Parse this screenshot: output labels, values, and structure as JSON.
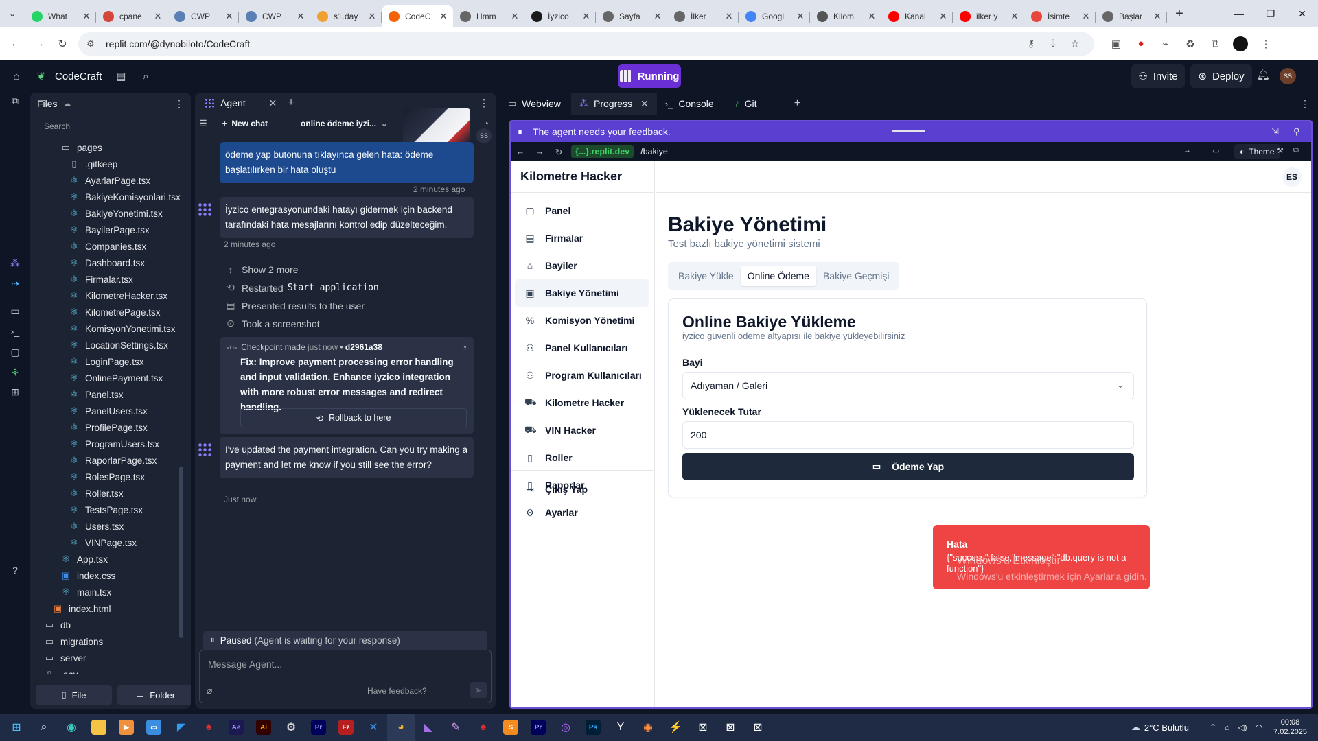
{
  "browser": {
    "tabs": [
      {
        "title": "What",
        "color": "#25d366",
        "active": false
      },
      {
        "title": "cpane",
        "color": "#d44638",
        "active": false
      },
      {
        "title": "CWP",
        "color": "#5a7fb5",
        "active": false
      },
      {
        "title": "CWP",
        "color": "#5a7fb5",
        "active": false
      },
      {
        "title": "s1.day",
        "color": "#f0a030",
        "active": false
      },
      {
        "title": "CodeC",
        "color": "#f26207",
        "active": true
      },
      {
        "title": "Hmm",
        "color": "#666666",
        "active": false
      },
      {
        "title": "İyzico",
        "color": "#1a1a1a",
        "active": false
      },
      {
        "title": "Sayfa",
        "color": "#666666",
        "active": false
      },
      {
        "title": "İlker",
        "color": "#666666",
        "active": false
      },
      {
        "title": "Googl",
        "color": "#4285f4",
        "active": false
      },
      {
        "title": "Kilom",
        "color": "#555555",
        "active": false
      },
      {
        "title": "Kanal",
        "color": "#ff0000",
        "active": false
      },
      {
        "title": "ilker y",
        "color": "#ff0000",
        "active": false
      },
      {
        "title": "İsimte",
        "color": "#e8453c",
        "active": false
      },
      {
        "title": "Başlar",
        "color": "#666666",
        "active": false
      }
    ],
    "url": "replit.com/@dynobiloto/CodeCraft"
  },
  "replit": {
    "project_name": "CodeCraft",
    "run_label": "Running",
    "invite_label": "Invite",
    "deploy_label": "Deploy",
    "avatar_initials": "SS"
  },
  "files": {
    "title": "Files",
    "search_placeholder": "Search",
    "tree": [
      {
        "name": "pages",
        "type": "folder",
        "depth": 1
      },
      {
        "name": ".gitkeep",
        "type": "file",
        "depth": 2
      },
      {
        "name": "AyarlarPage.tsx",
        "type": "react",
        "depth": 2
      },
      {
        "name": "BakiyeKomisyonlari.tsx",
        "type": "react",
        "depth": 2
      },
      {
        "name": "BakiyeYonetimi.tsx",
        "type": "react",
        "depth": 2
      },
      {
        "name": "BayilerPage.tsx",
        "type": "react",
        "depth": 2
      },
      {
        "name": "Companies.tsx",
        "type": "react",
        "depth": 2
      },
      {
        "name": "Dashboard.tsx",
        "type": "react",
        "depth": 2
      },
      {
        "name": "Firmalar.tsx",
        "type": "react",
        "depth": 2
      },
      {
        "name": "KilometreHacker.tsx",
        "type": "react",
        "depth": 2
      },
      {
        "name": "KilometrePage.tsx",
        "type": "react",
        "depth": 2
      },
      {
        "name": "KomisyonYonetimi.tsx",
        "type": "react",
        "depth": 2
      },
      {
        "name": "LocationSettings.tsx",
        "type": "react",
        "depth": 2
      },
      {
        "name": "LoginPage.tsx",
        "type": "react",
        "depth": 2
      },
      {
        "name": "OnlinePayment.tsx",
        "type": "react",
        "depth": 2
      },
      {
        "name": "Panel.tsx",
        "type": "react",
        "depth": 2
      },
      {
        "name": "PanelUsers.tsx",
        "type": "react",
        "depth": 2
      },
      {
        "name": "ProfilePage.tsx",
        "type": "react",
        "depth": 2
      },
      {
        "name": "ProgramUsers.tsx",
        "type": "react",
        "depth": 2
      },
      {
        "name": "RaporlarPage.tsx",
        "type": "react",
        "depth": 2
      },
      {
        "name": "RolesPage.tsx",
        "type": "react",
        "depth": 2
      },
      {
        "name": "Roller.tsx",
        "type": "react",
        "depth": 2
      },
      {
        "name": "TestsPage.tsx",
        "type": "react",
        "depth": 2
      },
      {
        "name": "Users.tsx",
        "type": "react",
        "depth": 2
      },
      {
        "name": "VINPage.tsx",
        "type": "react",
        "depth": 2
      },
      {
        "name": "App.tsx",
        "type": "react",
        "depth": 1
      },
      {
        "name": "index.css",
        "type": "css",
        "depth": 1
      },
      {
        "name": "main.tsx",
        "type": "react",
        "depth": 1
      },
      {
        "name": "index.html",
        "type": "html",
        "depth": 0
      },
      {
        "name": "db",
        "type": "folder",
        "depth": -1
      },
      {
        "name": "migrations",
        "type": "folder",
        "depth": -1
      },
      {
        "name": "server",
        "type": "folder",
        "depth": -1
      },
      {
        "name": ".env",
        "type": "file",
        "depth": -1
      }
    ],
    "add_file_label": "File",
    "add_folder_label": "Folder"
  },
  "agent": {
    "tab_label": "Agent",
    "new_chat_label": "New chat",
    "chat_title": "online ödeme iyzi...",
    "user_message": "ödeme yap butonuna tıklayınca gelen hata: ödeme başlatılırken bir hata oluştu",
    "user_time": "2 minutes ago",
    "user_avatar": "SS",
    "agent_message_1": "İyzico entegrasyonundaki hatayı gidermek için backend tarafındaki hata mesajlarını kontrol edip düzelteceğim.",
    "agent_time_1": "2 minutes ago",
    "show_more": "Show 2 more",
    "action_restarted": "Restarted",
    "action_restarted_code": "Start application",
    "action_presented": "Presented results to the user",
    "action_screenshot": "Took a screenshot",
    "checkpoint_label": "Checkpoint made",
    "checkpoint_time": "just now",
    "checkpoint_hash": "d2961a38",
    "checkpoint_message": "Fix: Improve payment processing error handling and input validation. Enhance iyzico integration with more robust error messages and redirect handling.",
    "rollback_label": "Rollback to here",
    "agent_message_2": "I've updated the payment integration. Can you try making a payment and let me know if you still see the error?",
    "agent_time_2": "Just now",
    "paused_label": "Paused",
    "paused_detail": "(Agent is waiting for your response)",
    "input_placeholder": "Message Agent...",
    "feedback_label": "Have feedback?"
  },
  "right_tabs": {
    "webview": "Webview",
    "progress": "Progress",
    "console": "Console",
    "git": "Git"
  },
  "webview": {
    "feedback_banner": "The agent needs your feedback.",
    "domain": "{...}.replit.dev",
    "path": "/bakiye",
    "theme_label": "Theme"
  },
  "app": {
    "brand": "Kilometre Hacker",
    "user_initials": "ES",
    "nav": [
      {
        "label": "Panel",
        "icon": "▢",
        "active": false
      },
      {
        "label": "Firmalar",
        "icon": "▤",
        "active": false
      },
      {
        "label": "Bayiler",
        "icon": "⌂",
        "active": false
      },
      {
        "label": "Bakiye Yönetimi",
        "icon": "▣",
        "active": true
      },
      {
        "label": "Komisyon Yönetimi",
        "icon": "%",
        "active": false
      },
      {
        "label": "Panel Kullanıcıları",
        "icon": "⚇",
        "active": false
      },
      {
        "label": "Program Kullanıcıları",
        "icon": "⚇",
        "active": false
      },
      {
        "label": "Kilometre Hacker",
        "icon": "⛟",
        "active": false
      },
      {
        "label": "VIN Hacker",
        "icon": "⛟",
        "active": false
      },
      {
        "label": "Roller",
        "icon": "▯",
        "active": false
      },
      {
        "label": "Raporlar",
        "icon": "▯",
        "active": false
      },
      {
        "label": "Ayarlar",
        "icon": "⚙",
        "active": false
      }
    ],
    "logout_label": "Çıkış Yap",
    "page_title": "Bakiye Yönetimi",
    "page_subtitle": "Test bazlı bakiye yönetimi sistemi",
    "tabs": [
      {
        "label": "Bakiye Yükle",
        "active": false
      },
      {
        "label": "Online Ödeme",
        "active": true
      },
      {
        "label": "Bakiye Geçmişi",
        "active": false
      }
    ],
    "card_title": "Online Bakiye Yükleme",
    "card_description": "iyzico güvenli ödeme altyapısı ile bakiye yükleyebilirsiniz",
    "dealer_label": "Bayi",
    "dealer_value": "Adıyaman / Galeri",
    "amount_label": "Yüklenecek Tutar",
    "amount_value": "200",
    "pay_button": "Ödeme Yap",
    "toast_title": "Hata",
    "toast_message": "{\"success\":false,\"message\":\"db.query is not a function\"}"
  },
  "windows_watermark": {
    "line1": "Windows'u Etkinleştir",
    "line2": "Windows'u etkinleştirmek için Ayarlar'a gidin."
  },
  "taskbar": {
    "weather": "2°C  Bulutlu",
    "time": "00:08",
    "date": "7.02.2025"
  }
}
